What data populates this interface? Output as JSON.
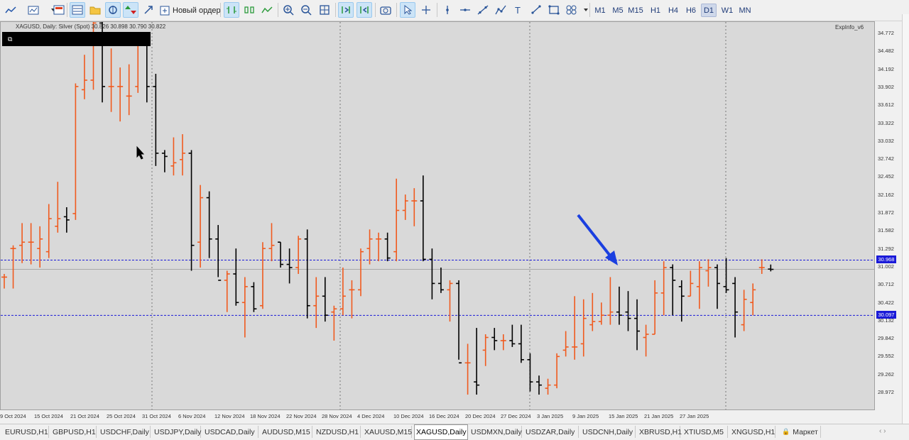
{
  "toolbar": {
    "new_order_label": "Новый ордер",
    "timeframes": [
      "M1",
      "M5",
      "M15",
      "H1",
      "H4",
      "H6",
      "D1",
      "W1",
      "MN"
    ],
    "active_timeframe": "D1",
    "icons": [
      "line-chart-icon",
      "template-icon",
      "profile-icon",
      "autoscroll-icon",
      "chart-shift-icon",
      "crosshair-icon",
      "trade-icon",
      "fullscreen-icon",
      "new-order-icon",
      "bar-chart-icon",
      "candle-chart-icon",
      "line-mode-icon",
      "zoom-in-icon",
      "zoom-out-icon",
      "grid-icon",
      "autoscroll-toggle-icon",
      "chart-shift-toggle-icon",
      "screenshot-icon",
      "cursor-icon",
      "crosshair-tool-icon",
      "vertical-line-icon",
      "horizontal-line-icon",
      "trend-line-icon",
      "fibonacci-icon",
      "text-icon",
      "arrow-tool-icon",
      "rectangle-icon",
      "shapes-icon"
    ]
  },
  "chart": {
    "symbol_header": "XAGUSD, Daily:  Silver (Spot)  30.826 30.898 30.790 30.822",
    "indicator_label": "ExpInfo_v6",
    "bull_color": "#f05a1e",
    "bear_color": "#000000",
    "level_color": "#1a1ad8",
    "background": "#d9d9d9",
    "highlight_arrow_color": "#1a3fe0"
  },
  "price_axis": {
    "ticks": [
      "34.772",
      "34.482",
      "34.192",
      "33.902",
      "33.612",
      "33.322",
      "33.032",
      "32.742",
      "32.452",
      "32.162",
      "31.872",
      "31.582",
      "31.292",
      "31.002",
      "30.712",
      "30.422",
      "30.132",
      "29.842",
      "29.552",
      "29.262",
      "28.972"
    ],
    "level_upper": "30.968",
    "level_lower": "30.097"
  },
  "date_axis": {
    "labels": [
      "9 Oct 2024",
      "15 Oct 2024",
      "21 Oct 2024",
      "25 Oct 2024",
      "31 Oct 2024",
      "6 Nov 2024",
      "12 Nov 2024",
      "18 Nov 2024",
      "22 Nov 2024",
      "28 Nov 2024",
      "4 Dec 2024",
      "10 Dec 2024",
      "16 Dec 2024",
      "20 Dec 2024",
      "27 Dec 2024",
      "3 Jan 2025",
      "9 Jan 2025",
      "15 Jan 2025",
      "21 Jan 2025",
      "27 Jan 2025"
    ]
  },
  "tabs": [
    "EURUSD,H1",
    "GBPUSD,H1",
    "USDCHF,Daily",
    "USDJPY,Daily",
    "USDCAD,Daily",
    "AUDUSD,M15",
    "NZDUSD,H1",
    "XAUUSD,M15",
    "XAGUSD,Daily",
    "USDMXN,Daily",
    "USDZAR,Daily",
    "USDCNH,Daily",
    "XBRUSD,H1",
    "XTIUSD,M5",
    "XNGUSD,H1",
    "Маркет"
  ],
  "active_tab": "XAGUSD,Daily",
  "chart_data": {
    "type": "bar",
    "bars": [
      {
        "date": "2024-10-09",
        "o": 30.7,
        "h": 30.75,
        "l": 30.52,
        "c": 30.7
      },
      {
        "date": "2024-10-10",
        "o": 31.15,
        "h": 31.2,
        "l": 30.52,
        "c": 31.15
      },
      {
        "date": "2024-10-11",
        "o": 31.2,
        "h": 31.55,
        "l": 30.92,
        "c": 31.25
      },
      {
        "date": "2024-10-14",
        "o": 31.25,
        "h": 31.55,
        "l": 30.9,
        "c": 31.25
      },
      {
        "date": "2024-10-15",
        "o": 31.15,
        "h": 31.5,
        "l": 30.85,
        "c": 31.3
      },
      {
        "date": "2024-10-16",
        "o": 31.1,
        "h": 31.85,
        "l": 31.0,
        "c": 31.62
      },
      {
        "date": "2024-10-17",
        "o": 31.5,
        "h": 32.2,
        "l": 31.4,
        "c": 31.62
      },
      {
        "date": "2024-10-18",
        "o": 31.65,
        "h": 31.8,
        "l": 31.4,
        "c": 31.6
      },
      {
        "date": "2024-10-21",
        "o": 31.7,
        "h": 33.75,
        "l": 31.6,
        "c": 33.7
      },
      {
        "date": "2024-10-22",
        "o": 33.65,
        "h": 34.2,
        "l": 33.5,
        "c": 33.8
      },
      {
        "date": "2024-10-23",
        "o": 33.8,
        "h": 34.75,
        "l": 33.65,
        "c": 34.7
      },
      {
        "date": "2024-10-24",
        "o": 34.7,
        "h": 34.8,
        "l": 33.45,
        "c": 33.7
      },
      {
        "date": "2024-10-25",
        "o": 33.7,
        "h": 34.3,
        "l": 33.3,
        "c": 33.7
      },
      {
        "date": "2024-10-28",
        "o": 33.7,
        "h": 34.0,
        "l": 33.15,
        "c": 33.7
      },
      {
        "date": "2024-10-29",
        "o": 33.55,
        "h": 34.05,
        "l": 33.25,
        "c": 33.55
      },
      {
        "date": "2024-10-30",
        "o": 33.7,
        "h": 34.55,
        "l": 33.6,
        "c": 34.45
      },
      {
        "date": "2024-10-31",
        "o": 34.45,
        "h": 34.55,
        "l": 33.45,
        "c": 33.7
      },
      {
        "date": "2024-11-01",
        "o": 33.7,
        "h": 33.9,
        "l": 32.45,
        "c": 32.65
      },
      {
        "date": "2024-11-04",
        "o": 32.65,
        "h": 32.7,
        "l": 32.35,
        "c": 32.6
      },
      {
        "date": "2024-11-05",
        "o": 32.45,
        "h": 32.9,
        "l": 32.3,
        "c": 32.5
      },
      {
        "date": "2024-11-06",
        "o": 32.55,
        "h": 32.95,
        "l": 32.3,
        "c": 32.65
      },
      {
        "date": "2024-11-07",
        "o": 32.65,
        "h": 32.7,
        "l": 30.8,
        "c": 31.2
      },
      {
        "date": "2024-11-08",
        "o": 31.25,
        "h": 32.15,
        "l": 30.85,
        "c": 31.95
      },
      {
        "date": "2024-11-11",
        "o": 31.95,
        "h": 32.05,
        "l": 31.0,
        "c": 31.3
      },
      {
        "date": "2024-11-12",
        "o": 31.3,
        "h": 31.52,
        "l": 30.7,
        "c": 30.65
      },
      {
        "date": "2024-11-13",
        "o": 30.65,
        "h": 30.8,
        "l": 30.15,
        "c": 30.75
      },
      {
        "date": "2024-11-14",
        "o": 30.75,
        "h": 31.15,
        "l": 30.25,
        "c": 30.3
      },
      {
        "date": "2024-11-15",
        "o": 30.3,
        "h": 30.7,
        "l": 29.75,
        "c": 30.55
      },
      {
        "date": "2024-11-18",
        "o": 30.55,
        "h": 30.62,
        "l": 30.15,
        "c": 30.2
      },
      {
        "date": "2024-11-19",
        "o": 30.25,
        "h": 31.25,
        "l": 30.2,
        "c": 31.15
      },
      {
        "date": "2024-11-20",
        "o": 31.15,
        "h": 31.55,
        "l": 30.95,
        "c": 31.2
      },
      {
        "date": "2024-11-21",
        "o": 31.25,
        "h": 31.25,
        "l": 30.85,
        "c": 30.9
      },
      {
        "date": "2024-11-22",
        "o": 30.9,
        "h": 31.15,
        "l": 30.6,
        "c": 30.85
      },
      {
        "date": "2024-11-25",
        "o": 30.85,
        "h": 31.35,
        "l": 30.75,
        "c": 31.3
      },
      {
        "date": "2024-11-26",
        "o": 31.3,
        "h": 31.45,
        "l": 30.05,
        "c": 30.25
      },
      {
        "date": "2024-11-27",
        "o": 30.25,
        "h": 30.7,
        "l": 29.9,
        "c": 30.4
      },
      {
        "date": "2024-11-28",
        "o": 30.4,
        "h": 30.7,
        "l": 30.0,
        "c": 30.1
      },
      {
        "date": "2024-11-29",
        "o": 30.15,
        "h": 30.25,
        "l": 29.7,
        "c": 30.2
      },
      {
        "date": "2024-12-02",
        "o": 30.2,
        "h": 30.85,
        "l": 30.1,
        "c": 30.4
      },
      {
        "date": "2024-12-03",
        "o": 30.5,
        "h": 30.65,
        "l": 30.05,
        "c": 30.5
      },
      {
        "date": "2024-12-04",
        "o": 30.5,
        "h": 31.15,
        "l": 30.4,
        "c": 31.1
      },
      {
        "date": "2024-12-05",
        "o": 31.15,
        "h": 31.45,
        "l": 30.9,
        "c": 31.3
      },
      {
        "date": "2024-12-06",
        "o": 31.3,
        "h": 31.4,
        "l": 30.95,
        "c": 31.3
      },
      {
        "date": "2024-12-09",
        "o": 31.3,
        "h": 31.4,
        "l": 30.95,
        "c": 31.0
      },
      {
        "date": "2024-12-10",
        "o": 31.1,
        "h": 32.25,
        "l": 30.95,
        "c": 31.75
      },
      {
        "date": "2024-12-11",
        "o": 31.75,
        "h": 32.0,
        "l": 31.6,
        "c": 31.9
      },
      {
        "date": "2024-12-12",
        "o": 31.9,
        "h": 32.1,
        "l": 31.5,
        "c": 31.9
      },
      {
        "date": "2024-12-13",
        "o": 31.9,
        "h": 32.3,
        "l": 30.95,
        "c": 30.98
      },
      {
        "date": "2024-12-16",
        "o": 30.98,
        "h": 31.15,
        "l": 30.35,
        "c": 30.6
      },
      {
        "date": "2024-12-17",
        "o": 30.6,
        "h": 30.85,
        "l": 30.45,
        "c": 30.5
      },
      {
        "date": "2024-12-18",
        "o": 30.5,
        "h": 30.65,
        "l": 30.0,
        "c": 30.6
      },
      {
        "date": "2024-12-19",
        "o": 30.6,
        "h": 30.65,
        "l": 29.4,
        "c": 29.35
      },
      {
        "date": "2024-12-20",
        "o": 29.35,
        "h": 29.65,
        "l": 28.85,
        "c": 29.35
      },
      {
        "date": "2024-12-23",
        "o": 29.05,
        "h": 29.9,
        "l": 28.85,
        "c": 29.0
      },
      {
        "date": "2024-12-24",
        "o": 29.55,
        "h": 29.8,
        "l": 29.3,
        "c": 29.75
      },
      {
        "date": "2024-12-26",
        "o": 29.75,
        "h": 29.9,
        "l": 29.55,
        "c": 29.7
      },
      {
        "date": "2024-12-27",
        "o": 29.7,
        "h": 29.8,
        "l": 29.55,
        "c": 29.7
      },
      {
        "date": "2024-12-30",
        "o": 29.7,
        "h": 29.95,
        "l": 29.6,
        "c": 29.65
      },
      {
        "date": "2024-12-31",
        "o": 29.65,
        "h": 29.95,
        "l": 29.35,
        "c": 29.4
      },
      {
        "date": "2025-01-02",
        "o": 29.4,
        "h": 29.5,
        "l": 28.9,
        "c": 29.05
      },
      {
        "date": "2025-01-03",
        "o": 29.05,
        "h": 29.15,
        "l": 28.85,
        "c": 29.0
      },
      {
        "date": "2025-01-06",
        "o": 28.95,
        "h": 29.1,
        "l": 28.85,
        "c": 29.0
      },
      {
        "date": "2025-01-07",
        "o": 29.0,
        "h": 29.5,
        "l": 28.95,
        "c": 29.45
      },
      {
        "date": "2025-01-08",
        "o": 29.55,
        "h": 29.85,
        "l": 29.45,
        "c": 29.6
      },
      {
        "date": "2025-01-09",
        "o": 29.6,
        "h": 30.4,
        "l": 29.4,
        "c": 29.6
      },
      {
        "date": "2025-01-10",
        "o": 29.65,
        "h": 30.35,
        "l": 29.45,
        "c": 30.05
      },
      {
        "date": "2025-01-13",
        "o": 29.95,
        "h": 30.45,
        "l": 29.85,
        "c": 30.0
      },
      {
        "date": "2025-01-14",
        "o": 30.0,
        "h": 30.3,
        "l": 29.95,
        "c": 30.1
      },
      {
        "date": "2025-01-15",
        "o": 30.1,
        "h": 30.7,
        "l": 29.95,
        "c": 30.15
      },
      {
        "date": "2025-01-16",
        "o": 30.15,
        "h": 30.55,
        "l": 29.95,
        "c": 30.1
      },
      {
        "date": "2025-01-17",
        "o": 30.15,
        "h": 30.48,
        "l": 29.85,
        "c": 30.05
      },
      {
        "date": "2025-01-20",
        "o": 30.05,
        "h": 30.35,
        "l": 29.55,
        "c": 29.85
      },
      {
        "date": "2025-01-21",
        "o": 29.75,
        "h": 29.95,
        "l": 29.45,
        "c": 29.8
      },
      {
        "date": "2025-01-22",
        "o": 29.8,
        "h": 30.65,
        "l": 29.8,
        "c": 30.45
      },
      {
        "date": "2025-01-23",
        "o": 30.45,
        "h": 30.95,
        "l": 30.1,
        "c": 30.85
      },
      {
        "date": "2025-01-24",
        "o": 30.85,
        "h": 30.9,
        "l": 30.1,
        "c": 30.65
      },
      {
        "date": "2025-01-27",
        "o": 30.55,
        "h": 30.65,
        "l": 30.0,
        "c": 30.4
      },
      {
        "date": "2025-01-28",
        "o": 30.4,
        "h": 30.8,
        "l": 30.4,
        "c": 30.6
      },
      {
        "date": "2025-01-29",
        "o": 30.55,
        "h": 30.95,
        "l": 30.2,
        "c": 30.85
      },
      {
        "date": "2025-01-30",
        "o": 30.8,
        "h": 30.98,
        "l": 30.55,
        "c": 30.85
      },
      {
        "date": "2025-01-31",
        "o": 30.85,
        "h": 30.9,
        "l": 30.2,
        "c": 30.6
      },
      {
        "date": "2025-02-03",
        "o": 30.55,
        "h": 31.0,
        "l": 30.45,
        "c": 30.5
      },
      {
        "date": "2025-02-04",
        "o": 30.6,
        "h": 30.7,
        "l": 29.75,
        "c": 30.15
      },
      {
        "date": "2025-02-05",
        "o": 29.95,
        "h": 30.5,
        "l": 29.85,
        "c": 30.35
      },
      {
        "date": "2025-02-06",
        "o": 30.3,
        "h": 30.6,
        "l": 30.1,
        "c": 30.5
      },
      {
        "date": "2025-02-07",
        "o": 30.85,
        "h": 30.98,
        "l": 30.75,
        "c": 30.85
      },
      {
        "date": "2025-02-10",
        "o": 30.826,
        "h": 30.898,
        "l": 30.79,
        "c": 30.822
      }
    ],
    "ylim": [
      28.75,
      34.85
    ],
    "levels": [
      30.968,
      30.097
    ]
  }
}
